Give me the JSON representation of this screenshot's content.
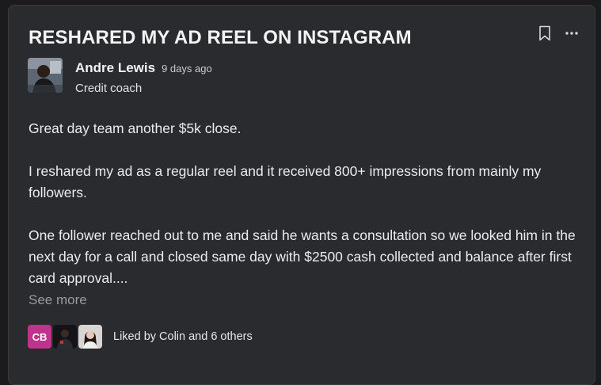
{
  "post": {
    "title": "RESHARED MY AD REEL ON INSTAGRAM",
    "author": {
      "name": "Andre Lewis",
      "time": "9 days ago",
      "role": "Credit coach"
    },
    "paragraphs": [
      "Great day team another $5k close.",
      "I reshared my ad as a regular reel and it received 800+ impressions from mainly my followers.",
      "One follower reached out to me and said he wants a consultation so we looked him in the next day for a call and closed same day with $2500 cash collected and balance after first card approval...."
    ],
    "see_more": "See more",
    "likes": {
      "first_liker_initials": "CB",
      "text": "Liked by Colin and 6 others"
    }
  },
  "icons": {
    "bookmark": "bookmark-icon",
    "more": "more-horizontal-icon"
  },
  "colors": {
    "card_background": "#2a2b2f",
    "page_background": "#1b1b1e",
    "initials_avatar": "#c0338c"
  }
}
